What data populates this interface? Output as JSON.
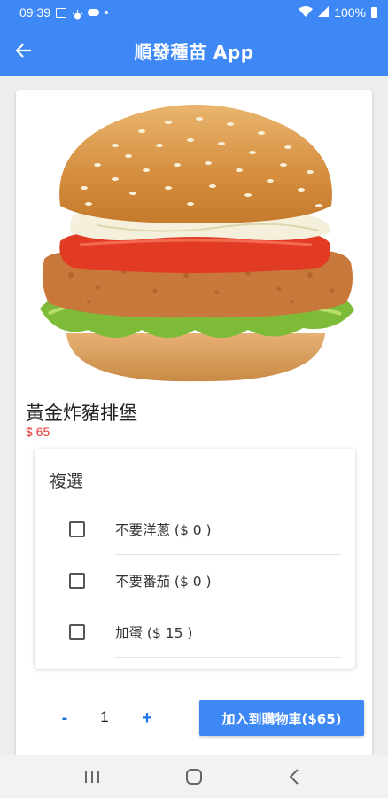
{
  "status_bar": {
    "time": "09:39",
    "battery": "100%"
  },
  "app_bar": {
    "title": "順發種苗 App"
  },
  "product": {
    "name": "黃金炸豬排堡",
    "price": "$ 65"
  },
  "options": {
    "title": "複選",
    "items": [
      {
        "label": "不要洋蔥 ($ 0 )",
        "checked": false
      },
      {
        "label": "不要番茄 ($ 0 )",
        "checked": false
      },
      {
        "label": "加蛋 ($ 15 )",
        "checked": false
      }
    ]
  },
  "quantity": {
    "minus": "-",
    "value": "1",
    "plus": "+"
  },
  "cart_button": {
    "label": "加入到購物車($65)"
  },
  "colors": {
    "primary": "#3d88f5",
    "price": "#e53935",
    "accent": "#1e72e8"
  },
  "icons": {
    "back": "arrow-left-icon",
    "nav_recent": "recent-apps-icon",
    "nav_home": "home-icon",
    "nav_back": "chevron-left-icon"
  }
}
